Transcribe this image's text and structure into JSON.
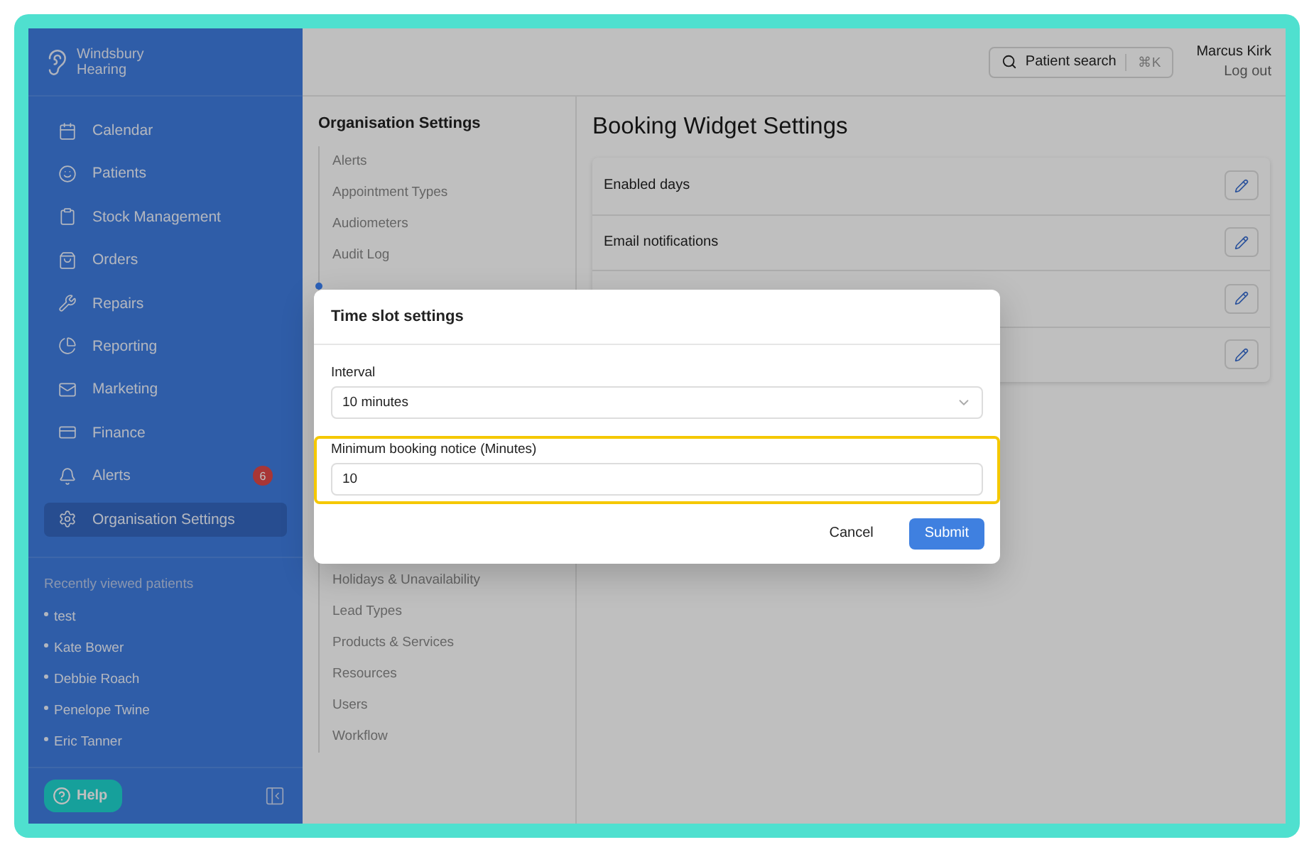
{
  "brand": {
    "line1": "Windsbury",
    "line2": "Hearing"
  },
  "nav": [
    {
      "label": "Calendar",
      "selected": false
    },
    {
      "label": "Patients",
      "selected": false
    },
    {
      "label": "Stock Management",
      "selected": false
    },
    {
      "label": "Orders",
      "selected": false
    },
    {
      "label": "Repairs",
      "selected": false
    },
    {
      "label": "Reporting",
      "selected": false
    },
    {
      "label": "Marketing",
      "selected": false
    },
    {
      "label": "Finance",
      "selected": false
    },
    {
      "label": "Alerts",
      "selected": false,
      "badge": "6"
    },
    {
      "label": "Organisation Settings",
      "selected": true
    }
  ],
  "recent": {
    "title": "Recently viewed patients",
    "patients": [
      "test",
      "Kate Bower",
      "Debbie Roach",
      "Penelope Twine",
      "Eric Tanner"
    ]
  },
  "help_button": "Help",
  "header": {
    "search": {
      "label": "Patient search",
      "shortcut": "⌘K"
    },
    "user": "Marcus Kirk",
    "logout": "Log out"
  },
  "settings_nav": {
    "title": "Organisation Settings",
    "items_top": [
      {
        "label": "Alerts",
        "selected": false
      },
      {
        "label": "Appointment Types",
        "selected": false
      },
      {
        "label": "Audiometers",
        "selected": false
      },
      {
        "label": "Audit Log",
        "selected": false
      },
      {
        "selected": true
      }
    ],
    "items_bottom": [
      {
        "label": "Holidays & Unavailability",
        "selected": false
      },
      {
        "label": "Lead Types",
        "selected": false
      },
      {
        "label": "Products & Services",
        "selected": false
      },
      {
        "label": "Resources",
        "selected": false
      },
      {
        "label": "Users",
        "selected": false
      },
      {
        "label": "Workflow",
        "selected": false
      }
    ]
  },
  "page": {
    "title": "Booking Widget Settings",
    "rows": [
      {
        "label": "Enabled days"
      },
      {
        "label": "Email notifications"
      },
      {},
      {}
    ]
  },
  "dialog": {
    "title": "Time slot settings",
    "fields": [
      {
        "kind": "select",
        "label": "Interval",
        "value": "10 minutes",
        "highlighted": false
      },
      {
        "kind": "input",
        "label": "Minimum booking notice (Minutes)",
        "value": "10",
        "highlighted": true
      }
    ],
    "buttons": [
      {
        "label": "Cancel",
        "primary": false
      },
      {
        "label": "Submit",
        "primary": true
      }
    ]
  }
}
